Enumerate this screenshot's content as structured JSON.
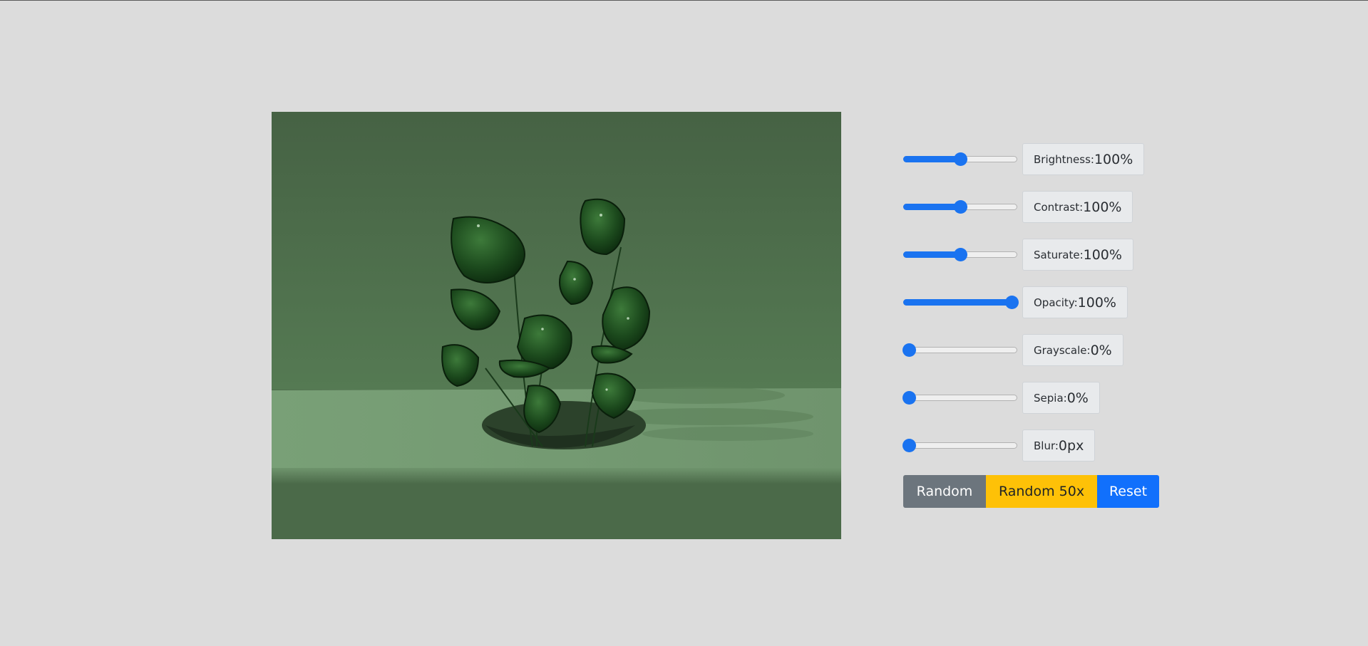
{
  "preview": {
    "image": "glass-plant-on-green-surface"
  },
  "sliders": [
    {
      "key": "brightness",
      "label": "Brightness:",
      "value": "100%",
      "position": 0.5
    },
    {
      "key": "contrast",
      "label": "Contrast:",
      "value": "100%",
      "position": 0.5
    },
    {
      "key": "saturate",
      "label": "Saturate:",
      "value": "100%",
      "position": 0.5
    },
    {
      "key": "opacity",
      "label": "Opacity:",
      "value": "100%",
      "position": 0.95
    },
    {
      "key": "grayscale",
      "label": "Grayscale:",
      "value": "0%",
      "position": 0.05
    },
    {
      "key": "sepia",
      "label": "Sepia:",
      "value": "0%",
      "position": 0.05
    },
    {
      "key": "blur",
      "label": "Blur:",
      "value": "0px",
      "position": 0.05
    }
  ],
  "buttons": {
    "random": "Random",
    "random50": "Random 50x",
    "reset": "Reset"
  },
  "colors": {
    "accent": "#1a73f0",
    "secondary": "#6c757d",
    "warning": "#fec107",
    "primary": "#1170fc",
    "page_background": "#dcdcdc"
  }
}
